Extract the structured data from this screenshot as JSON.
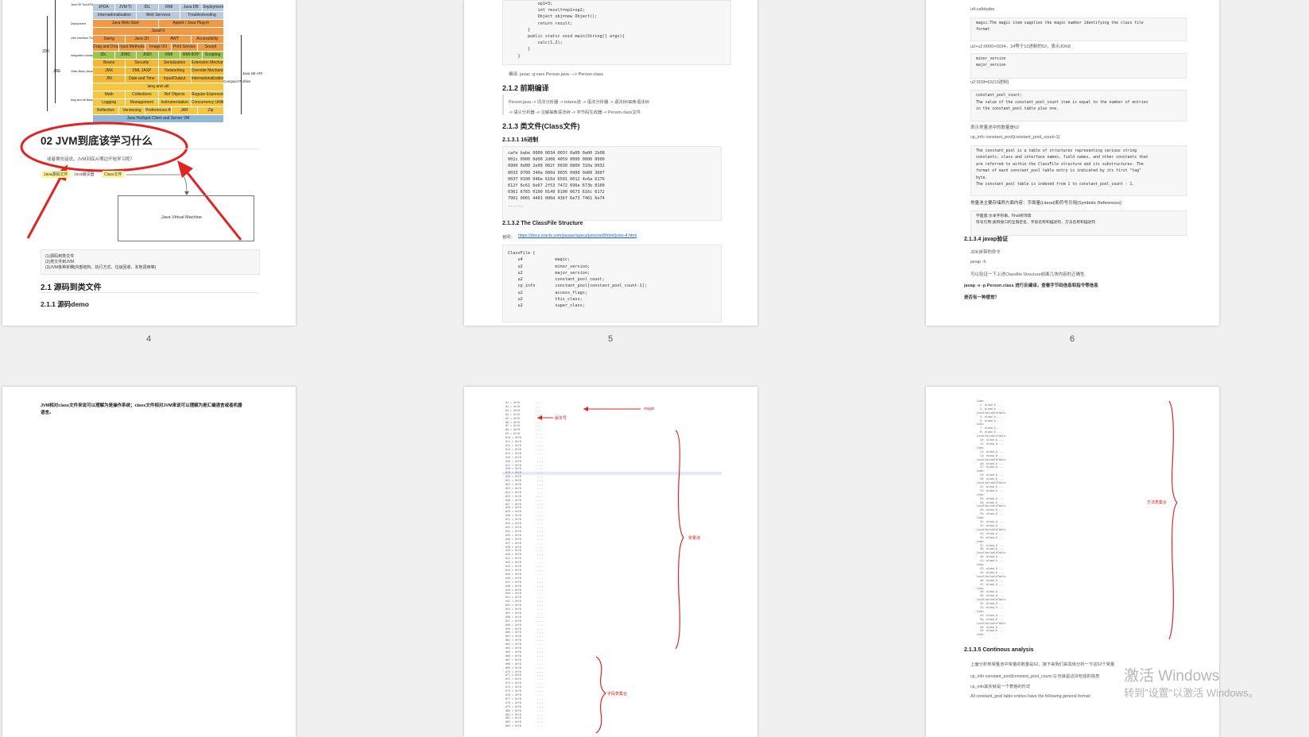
{
  "colors": {
    "bg": "#f0f0f0",
    "page": "#ffffff",
    "red": "#e02424",
    "code_bg": "#f7f7f7",
    "link": "#1a5fcc"
  },
  "page_numbers": [
    "4",
    "5",
    "6"
  ],
  "p4": {
    "heading": "02 JVM到底该学习什么",
    "sub": "或者换句话说，JVM到底从哪边开始学习呢？",
    "flow_src": "Java源码文件",
    "flow_mid": "Java编译器",
    "flow_class": "Class文件",
    "jvm_box": "Java Virtual Machine",
    "list": [
      "(1)源码到类文件",
      "(2)类文件到JVM",
      "(3)JVM各种折腾[内部结构、执行方式、垃圾回收、本地调用等]"
    ],
    "h21": "2.1 源码到类文件",
    "h211": "2.1.1 源码demo",
    "side_labels": [
      "JDK",
      "JRE",
      "Java SE API",
      "Compact Profiles"
    ],
    "arch_left": [
      "Java SE Tool APIs",
      "Deployment",
      "User Interface Toolkits",
      "Integration Libraries",
      "Other Base Libraries",
      "lang and util Base Libraries"
    ],
    "arch_rows": [
      [
        "JPDA",
        "JVM TI",
        "IDL",
        "RMI",
        "Java DB",
        "Deployment"
      ],
      [
        "Internationalization",
        "Web Services",
        "Troubleshooting"
      ],
      [
        "Java Web Start",
        "Applet / Java Plug-in"
      ],
      [
        "JavaFX"
      ],
      [
        "Swing",
        "Java 2D",
        "AWT",
        "Accessibility"
      ],
      [
        "Drag and Drop",
        "Input Methods",
        "Image I/O",
        "Print Service",
        "Sound"
      ],
      [
        "IDL",
        "JDBC",
        "JNDI",
        "RMI",
        "RMI-IIOP",
        "Scripting"
      ],
      [
        "Beans",
        "Security",
        "Serialization",
        "Extension Mechanism"
      ],
      [
        "JMX",
        "XML JAXP",
        "Networking",
        "Override Mechanism"
      ],
      [
        "JNI",
        "Date and Time",
        "Input/Output",
        "Internationalization"
      ],
      [
        "lang and util"
      ],
      [
        "Math",
        "Collections",
        "Ref Objects",
        "Regular Expressions"
      ],
      [
        "Logging",
        "Management",
        "Instrumentation",
        "Concurrency Utilities"
      ],
      [
        "Reflection",
        "Versioning",
        "Preferences API",
        "JAR",
        "Zip"
      ],
      [
        "Java HotSpot Client and Server VM"
      ]
    ]
  },
  "p5": {
    "code_top": [
      "            op1=3;",
      "            int result=op1+op2;",
      "            Object obj=new Object();",
      "            return result;",
      "        }",
      "        public static void main(String[] args){",
      "            calc(1,2);",
      "        }",
      "    }"
    ],
    "compile_note": "编译: javac -g:vars Person.java ---> Person.class",
    "h212": "2.1.2 前期编译",
    "flow1": "Person.java -> 词法分析器 -> tokens流 -> 语法分析器 -> 语法树/抽象语法树",
    "flow2": "-> 语义分析器 -> 注解抽象语法树 -> 字节码生成器 -> Person.class文件",
    "h213": "2.1.3 类文件(Class文件)",
    "h2131": "2.1.3.1 16进制",
    "hex": [
      "cafe babe 0000 0034 003f 0a00 0a00 2b08",
      "002c 0900 0d00 2d06 4059 0000 0000 0000",
      "0900 0d00 2e09 002f 0030 0800 310a 0032",
      "0033 0700 340a 000d 0035 0900 0d00 3607",
      "0037 0100 046e 616d 6501 0012 4c6a 6176",
      "612f 6c61 6e67 2f53 7472 696e 673b 0100",
      "0361 6765 0100 0149 0100 0673 616c 6172",
      "7901 0001 4401 000d 436f 6e73 7461 6e74",
      "......"
    ],
    "h2132": "2.1.3.2 The ClassFile Structure",
    "official_label": "官网：",
    "official_link": "https://docs.oracle.com/javase/specs/jvms/se8/html/jvms-4.html",
    "classfile": [
      "ClassFile {",
      "    u4             magic;",
      "    u2             minor_version;",
      "    u2             major_version;",
      "    u2             constant_pool_count;",
      "    cp_info        constant_pool[constant_pool_count-1];",
      "    u2             access_flags;",
      "    u2             this_class;",
      "    u2             super_class;"
    ]
  },
  "p6": {
    "l1": "u4:cafebabe",
    "c1": [
      "magic:The magic item supplies the magic number identifying the class file",
      "format"
    ],
    "l2": "u2+u2:0000+0034，34等于10进制的52，表示JDK8",
    "c2": [
      "minor_version",
      "major_version"
    ],
    "l3": "u2:003f=63(10进制)",
    "c3": [
      "constant_pool_count:",
      "The value of the constant_pool_count item is equal to the number of entries",
      "in the constant_pool table plus one."
    ],
    "l4": "表示常量池中的数量是62",
    "l5": "cp_info       constant_pool[constant_pool_count-1]",
    "c4": [
      "The constant_pool is a table of structures representing various string",
      "constants, class and interface names, field names, and other constants that",
      "are referred to within the ClassFile structure and its substructures. The",
      "format of each constant_pool table entry is indicated by its first \"tag\"",
      "byte.",
      "The constant_pool table is indexed from 1 to constant_pool_count - 1."
    ],
    "l6": "常量池主要存储两方面内容：字面量(Literal)和符号引用(Symbolic References)",
    "c5": [
      "字面量:文本字符串，final修饰等",
      "符号引用:类和接口的全限定名、字段名称和描述符、方法名称和描述符"
    ],
    "h2134": "2.1.3.4 javap验证",
    "l7": "JDK自带的命令",
    "l8": "javap -h",
    "l9": "可以验证一下上述Classfile Structure前面几块内容的正确性",
    "l10": "javap -v -p Person.class 进行反编译，查看字节码信息和指令等信息",
    "l11": "是否有一种感觉？"
  },
  "p7": {
    "text1": "JVM相对class文件来说可以理解为是操作系统；class文件相对JVM来说可以理解为是汇编语言或者机器",
    "text2": "语言。"
  },
  "p8": {
    "ann_magic": "magic",
    "ann_version": "版本号",
    "ann_pool": "常量池",
    "ann_fields": "字段表集合"
  },
  "p9": {
    "ann_methods": "方法表集合",
    "h2135": "2.1.3.5 Continous analysis",
    "l1": "上面分析到常量池中常量的数量是62，接下来我们来具体分析一下这62个常量",
    "l2": "cp_info    constant_pool[constant_pool_count-1]    也就是这块包括的信息",
    "l3": "cp_info其实就是一个表格的形式",
    "l4": "All  constant_pool  table entries have the following general format:"
  },
  "watermark": {
    "line1": "激活 Windows",
    "line2": "转到\"设置\"以激活 Windows。"
  }
}
